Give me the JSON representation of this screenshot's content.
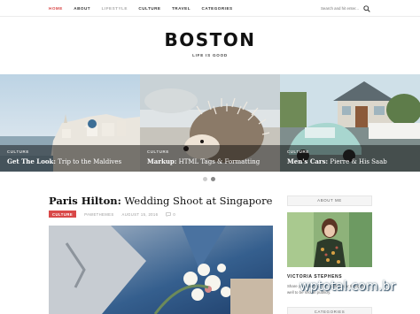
{
  "nav": {
    "items": [
      {
        "label": "HOME",
        "state": "active"
      },
      {
        "label": "ABOUT",
        "state": "normal"
      },
      {
        "label": "LIFESTYLE",
        "state": "muted"
      },
      {
        "label": "CULTURE",
        "state": "normal"
      },
      {
        "label": "TRAVEL",
        "state": "normal"
      },
      {
        "label": "CATEGORIES",
        "state": "normal"
      }
    ],
    "search_placeholder": "Search and hit enter..."
  },
  "brand": {
    "name": "BOSTON",
    "tagline": "LIFE IS GOOD"
  },
  "slider": {
    "slides": [
      {
        "category": "CULTURE",
        "title_bold": "Get The Look:",
        "title_rest": " Trip to the Maldives"
      },
      {
        "category": "CULTURE",
        "title_bold": "Markup:",
        "title_rest": " HTML Tags & Formatting"
      },
      {
        "category": "CULTURE",
        "title_bold": "Men's Cars:",
        "title_rest": " Pierre & His Saab"
      }
    ],
    "active_dot": 1
  },
  "post": {
    "title_bold": "Paris Hilton:",
    "title_rest": " Wedding Shoot at Singapore",
    "category": "CULTURE",
    "author": "PAWETHEMES",
    "date": "AUGUST 15, 2016",
    "comments": "0"
  },
  "sidebar": {
    "about_heading": "ABOUT ME",
    "name": "VICTORIA STEPHENS",
    "text": "Share your story so far. Gather your thoughts well to be shown publicly.",
    "categories_heading": "CATEGORIES"
  },
  "watermark": "wptotal.com.br",
  "colors": {
    "accent": "#d94848",
    "text": "#222222",
    "muted": "#999999"
  }
}
